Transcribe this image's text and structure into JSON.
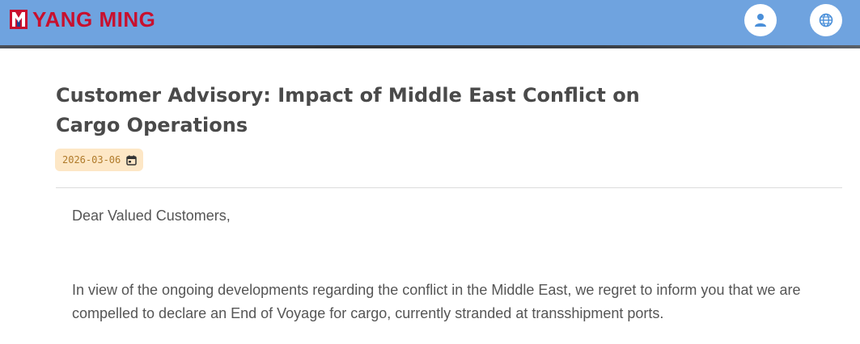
{
  "header": {
    "brand_name": "YANG MING",
    "brand_color": "#c8102e",
    "bar_color": "#6fa3df",
    "buttons": [
      {
        "icon": "user-icon"
      },
      {
        "icon": "globe-icon"
      }
    ]
  },
  "article": {
    "title": "Customer Advisory: Impact of Middle East Conflict on Cargo Operations",
    "date": "2026-03-06",
    "date_icon": "calendar-icon",
    "paragraphs": [
      "Dear Valued Customers,",
      "In view of the ongoing developments regarding the conflict in the Middle East, we regret to inform you that we are compelled to declare an End of Voyage for cargo,  currently stranded at transshipment ports."
    ]
  }
}
